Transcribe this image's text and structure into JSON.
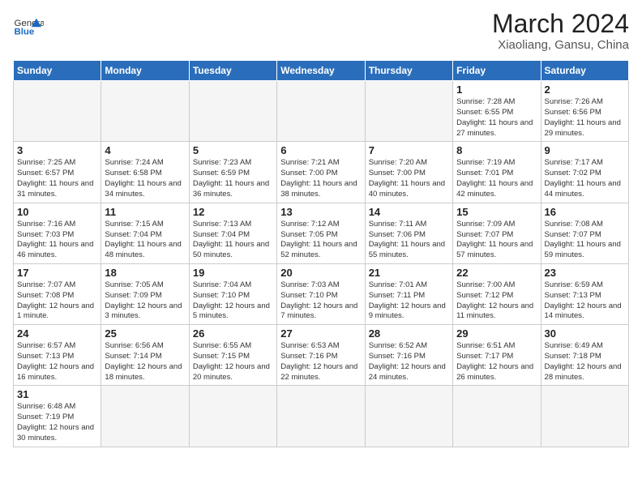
{
  "header": {
    "logo_general": "General",
    "logo_blue": "Blue",
    "month_title": "March 2024",
    "subtitle": "Xiaoliang, Gansu, China"
  },
  "weekdays": [
    "Sunday",
    "Monday",
    "Tuesday",
    "Wednesday",
    "Thursday",
    "Friday",
    "Saturday"
  ],
  "weeks": [
    [
      {
        "day": "",
        "info": ""
      },
      {
        "day": "",
        "info": ""
      },
      {
        "day": "",
        "info": ""
      },
      {
        "day": "",
        "info": ""
      },
      {
        "day": "",
        "info": ""
      },
      {
        "day": "1",
        "info": "Sunrise: 7:28 AM\nSunset: 6:55 PM\nDaylight: 11 hours and 27 minutes."
      },
      {
        "day": "2",
        "info": "Sunrise: 7:26 AM\nSunset: 6:56 PM\nDaylight: 11 hours and 29 minutes."
      }
    ],
    [
      {
        "day": "3",
        "info": "Sunrise: 7:25 AM\nSunset: 6:57 PM\nDaylight: 11 hours and 31 minutes."
      },
      {
        "day": "4",
        "info": "Sunrise: 7:24 AM\nSunset: 6:58 PM\nDaylight: 11 hours and 34 minutes."
      },
      {
        "day": "5",
        "info": "Sunrise: 7:23 AM\nSunset: 6:59 PM\nDaylight: 11 hours and 36 minutes."
      },
      {
        "day": "6",
        "info": "Sunrise: 7:21 AM\nSunset: 7:00 PM\nDaylight: 11 hours and 38 minutes."
      },
      {
        "day": "7",
        "info": "Sunrise: 7:20 AM\nSunset: 7:00 PM\nDaylight: 11 hours and 40 minutes."
      },
      {
        "day": "8",
        "info": "Sunrise: 7:19 AM\nSunset: 7:01 PM\nDaylight: 11 hours and 42 minutes."
      },
      {
        "day": "9",
        "info": "Sunrise: 7:17 AM\nSunset: 7:02 PM\nDaylight: 11 hours and 44 minutes."
      }
    ],
    [
      {
        "day": "10",
        "info": "Sunrise: 7:16 AM\nSunset: 7:03 PM\nDaylight: 11 hours and 46 minutes."
      },
      {
        "day": "11",
        "info": "Sunrise: 7:15 AM\nSunset: 7:04 PM\nDaylight: 11 hours and 48 minutes."
      },
      {
        "day": "12",
        "info": "Sunrise: 7:13 AM\nSunset: 7:04 PM\nDaylight: 11 hours and 50 minutes."
      },
      {
        "day": "13",
        "info": "Sunrise: 7:12 AM\nSunset: 7:05 PM\nDaylight: 11 hours and 52 minutes."
      },
      {
        "day": "14",
        "info": "Sunrise: 7:11 AM\nSunset: 7:06 PM\nDaylight: 11 hours and 55 minutes."
      },
      {
        "day": "15",
        "info": "Sunrise: 7:09 AM\nSunset: 7:07 PM\nDaylight: 11 hours and 57 minutes."
      },
      {
        "day": "16",
        "info": "Sunrise: 7:08 AM\nSunset: 7:07 PM\nDaylight: 11 hours and 59 minutes."
      }
    ],
    [
      {
        "day": "17",
        "info": "Sunrise: 7:07 AM\nSunset: 7:08 PM\nDaylight: 12 hours and 1 minute."
      },
      {
        "day": "18",
        "info": "Sunrise: 7:05 AM\nSunset: 7:09 PM\nDaylight: 12 hours and 3 minutes."
      },
      {
        "day": "19",
        "info": "Sunrise: 7:04 AM\nSunset: 7:10 PM\nDaylight: 12 hours and 5 minutes."
      },
      {
        "day": "20",
        "info": "Sunrise: 7:03 AM\nSunset: 7:10 PM\nDaylight: 12 hours and 7 minutes."
      },
      {
        "day": "21",
        "info": "Sunrise: 7:01 AM\nSunset: 7:11 PM\nDaylight: 12 hours and 9 minutes."
      },
      {
        "day": "22",
        "info": "Sunrise: 7:00 AM\nSunset: 7:12 PM\nDaylight: 12 hours and 11 minutes."
      },
      {
        "day": "23",
        "info": "Sunrise: 6:59 AM\nSunset: 7:13 PM\nDaylight: 12 hours and 14 minutes."
      }
    ],
    [
      {
        "day": "24",
        "info": "Sunrise: 6:57 AM\nSunset: 7:13 PM\nDaylight: 12 hours and 16 minutes."
      },
      {
        "day": "25",
        "info": "Sunrise: 6:56 AM\nSunset: 7:14 PM\nDaylight: 12 hours and 18 minutes."
      },
      {
        "day": "26",
        "info": "Sunrise: 6:55 AM\nSunset: 7:15 PM\nDaylight: 12 hours and 20 minutes."
      },
      {
        "day": "27",
        "info": "Sunrise: 6:53 AM\nSunset: 7:16 PM\nDaylight: 12 hours and 22 minutes."
      },
      {
        "day": "28",
        "info": "Sunrise: 6:52 AM\nSunset: 7:16 PM\nDaylight: 12 hours and 24 minutes."
      },
      {
        "day": "29",
        "info": "Sunrise: 6:51 AM\nSunset: 7:17 PM\nDaylight: 12 hours and 26 minutes."
      },
      {
        "day": "30",
        "info": "Sunrise: 6:49 AM\nSunset: 7:18 PM\nDaylight: 12 hours and 28 minutes."
      }
    ],
    [
      {
        "day": "31",
        "info": "Sunrise: 6:48 AM\nSunset: 7:19 PM\nDaylight: 12 hours and 30 minutes."
      },
      {
        "day": "",
        "info": ""
      },
      {
        "day": "",
        "info": ""
      },
      {
        "day": "",
        "info": ""
      },
      {
        "day": "",
        "info": ""
      },
      {
        "day": "",
        "info": ""
      },
      {
        "day": "",
        "info": ""
      }
    ]
  ]
}
